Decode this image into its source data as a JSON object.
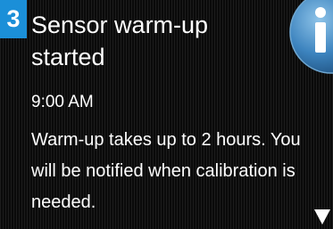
{
  "notification": {
    "step_number": "3",
    "title": "Sensor warm-up\nstarted",
    "time": "9:00 AM",
    "message": "Warm-up takes up to 2 hours. You will be notified when calibration is needed."
  },
  "icons": {
    "info": "info-icon",
    "scroll": "scroll-down-arrow-icon"
  },
  "colors": {
    "badge": "#1b8fd8",
    "background": "#121212",
    "text": "#ffffff"
  }
}
